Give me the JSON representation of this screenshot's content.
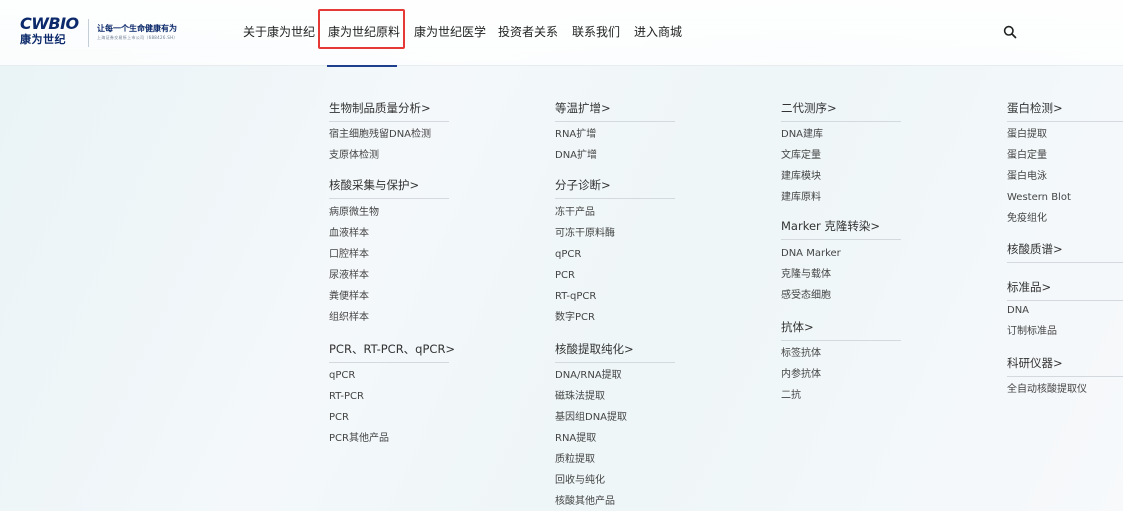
{
  "brand": {
    "logo_latin": "CWBIO",
    "logo_cn": "康为世纪",
    "slogan": "让每一个生命健康有为",
    "slogan_sub": "上海证券交易所上市公司（688426.SH）"
  },
  "nav": {
    "items": [
      "关于康为世纪",
      "康为世纪原料",
      "康为世纪医学",
      "投资者关系",
      "联系我们",
      "进入商城"
    ],
    "active_index": 1
  },
  "colors": {
    "active_border": "#e53935",
    "underline": "#1d3f8e",
    "brand_navy": "#0c2a6b"
  },
  "menu": {
    "columns": [
      {
        "groups": [
          {
            "heading": "生物制品质量分析>",
            "items": [
              "宿主细胞残留DNA检测",
              "支原体检测"
            ]
          },
          {
            "heading": "核酸采集与保护>",
            "items": [
              "病原微生物",
              "血液样本",
              "口腔样本",
              "尿液样本",
              "粪便样本",
              "组织样本"
            ]
          },
          {
            "heading": "PCR、RT-PCR、qPCR>",
            "items": [
              "qPCR",
              "RT-PCR",
              "PCR",
              "PCR其他产品"
            ]
          }
        ]
      },
      {
        "groups": [
          {
            "heading": "等温扩增>",
            "items": [
              "RNA扩增",
              "DNA扩增"
            ]
          },
          {
            "heading": "分子诊断>",
            "items": [
              "冻干产品",
              "可冻干原料酶",
              "qPCR",
              "PCR",
              "RT-qPCR",
              "数字PCR"
            ]
          },
          {
            "heading": "核酸提取纯化>",
            "items": [
              "DNA/RNA提取",
              "磁珠法提取",
              "基因组DNA提取",
              "RNA提取",
              "质粒提取",
              "回收与纯化",
              "核酸其他产品"
            ]
          }
        ]
      },
      {
        "groups": [
          {
            "heading": "二代测序>",
            "items": [
              "DNA建库",
              "文库定量",
              "建库模块",
              "建库原料"
            ]
          },
          {
            "heading": "Marker 克隆转染>",
            "items": [
              "DNA Marker",
              "克隆与载体",
              "感受态细胞"
            ]
          },
          {
            "heading": "抗体>",
            "items": [
              "标签抗体",
              "内参抗体",
              "二抗"
            ]
          }
        ]
      },
      {
        "groups": [
          {
            "heading": "蛋白检测>",
            "items": [
              "蛋白提取",
              "蛋白定量",
              "蛋白电泳",
              "Western Blot",
              "免疫组化"
            ]
          },
          {
            "heading": "核酸质谱>",
            "items": []
          },
          {
            "heading": "标准品>",
            "items": [
              "DNA",
              "订制标准品"
            ]
          },
          {
            "heading": "科研仪器>",
            "items": [
              "全自动核酸提取仪"
            ]
          }
        ]
      }
    ]
  }
}
